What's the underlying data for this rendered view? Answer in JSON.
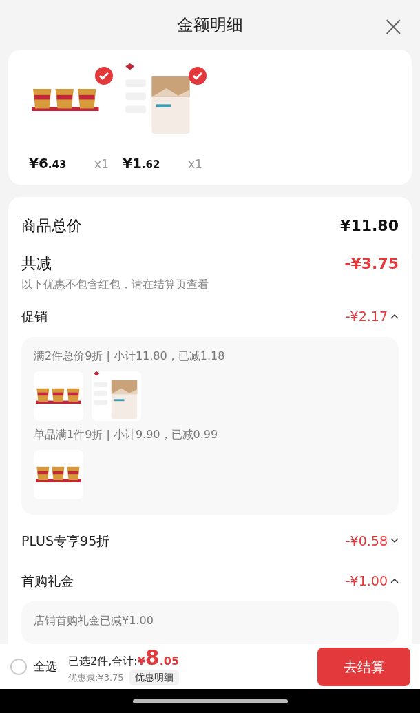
{
  "header": {
    "title": "金额明细",
    "close": "×"
  },
  "products": [
    {
      "kind": "picture",
      "selected": true,
      "price_main": "¥6",
      "price_decimal": ".43",
      "quantity": "x1"
    },
    {
      "kind": "picture",
      "selected": true,
      "price_main": "¥1",
      "price_decimal": ".62",
      "quantity": "x1"
    }
  ],
  "summary": {
    "total_label": "商品总价",
    "total_value": "¥11.80",
    "discount_label": "共减",
    "discount_value": "-¥3.75",
    "note": "以下优惠不包含红包，请在结算页查看"
  },
  "discounts": [
    {
      "label": "促销",
      "value": "-¥2.17",
      "expanded": true,
      "groups": [
        {
          "text": "满2件总价9折 | 小计11.80，已减1.18"
        },
        {
          "text": "单品满1件9折 | 小计9.90，已减0.99"
        }
      ]
    },
    {
      "label": "PLUS专享95折",
      "value": "-¥0.58",
      "expanded": false
    },
    {
      "label": "首购礼金",
      "value": "-¥1.00",
      "expanded": true,
      "groups": [
        {
          "text": "店铺首购礼金已减¥1.00"
        }
      ]
    }
  ],
  "footer": {
    "select_all": {
      "label": "全选",
      "checked": false
    },
    "selected_text": "已选2件,合计:",
    "currency": "¥",
    "total_main": "8",
    "total_decimal": ".05",
    "saved": "优惠减:¥3.75",
    "detail_button": "优惠明细",
    "checkout_button": "去结算"
  }
}
